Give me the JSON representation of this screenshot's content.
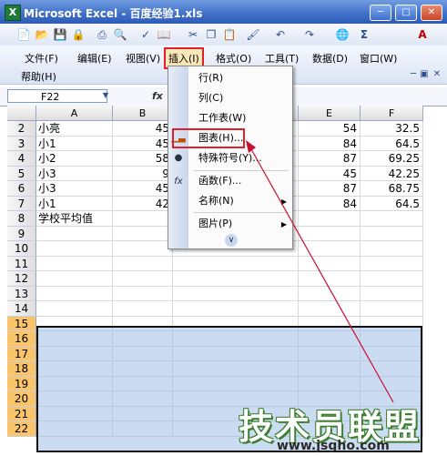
{
  "window": {
    "title": "Microsoft Excel - 百度经验1.xls",
    "app_icon": "X"
  },
  "menubar": {
    "items": [
      "文件(F)",
      "编辑(E)",
      "视图(V)",
      "插入(I)",
      "格式(O)",
      "工具(T)",
      "数据(D)",
      "窗口(W)"
    ],
    "help": "帮助(H)"
  },
  "formula_bar": {
    "name_box": "F22",
    "fx": "fx"
  },
  "columns": [
    "A",
    "B",
    "E",
    "F"
  ],
  "rows": [
    {
      "n": "2",
      "a": "小亮",
      "b": "45",
      "e": "54",
      "f": "32.5"
    },
    {
      "n": "3",
      "a": "小1",
      "b": "45",
      "e": "84",
      "f": "64.5"
    },
    {
      "n": "4",
      "a": "小2",
      "b": "58",
      "e": "87",
      "f": "69.25"
    },
    {
      "n": "5",
      "a": "小3",
      "b": "9",
      "e": "45",
      "f": "42.25"
    },
    {
      "n": "6",
      "a": "小3",
      "b": "45",
      "e": "87",
      "f": "68.75"
    },
    {
      "n": "7",
      "a": "小1",
      "b": "42",
      "e": "84",
      "f": "64.5"
    },
    {
      "n": "8",
      "a": "学校平均值",
      "b": "",
      "e": "",
      "f": ""
    },
    {
      "n": "9"
    },
    {
      "n": "10"
    },
    {
      "n": "11"
    },
    {
      "n": "12"
    },
    {
      "n": "13"
    },
    {
      "n": "14"
    },
    {
      "n": "15"
    },
    {
      "n": "16"
    },
    {
      "n": "17"
    },
    {
      "n": "18"
    },
    {
      "n": "19"
    },
    {
      "n": "20"
    },
    {
      "n": "21"
    },
    {
      "n": "22"
    }
  ],
  "insert_menu": {
    "items": [
      "行(R)",
      "列(C)",
      "工作表(W)",
      "图表(H)...",
      "特殊符号(Y)...",
      "函数(F)...",
      "名称(N)",
      "图片(P)"
    ]
  },
  "watermark": {
    "text": "技术员联盟",
    "url": "www.jsgho.com"
  }
}
